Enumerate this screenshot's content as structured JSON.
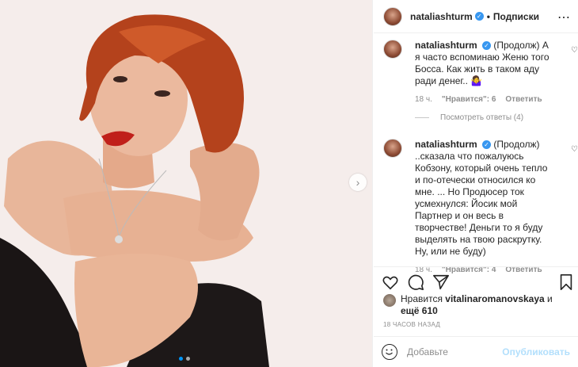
{
  "post": {
    "username": "nataliashturm",
    "separator": "•",
    "follow_label": "Подписки",
    "more_icon": "ellipsis-icon"
  },
  "comments": [
    {
      "username": "nataliashturm",
      "prefix": "(Продолж)",
      "text": "А я часто вспоминаю Женю того Босса. Как жить в таком аду ради денег..",
      "emoji": "🤷‍♀️",
      "time": "18 ч.",
      "likes": "\"Нравится\": 6",
      "reply": "Ответить"
    },
    {
      "username": "nataliashturm",
      "prefix": "(Продолж)",
      "text": "..сказала что пожалуюсь Кобзону, который очень тепло и по-отечески относился ко мне. ... Но Продюсер ток усмехнулся: Йосик мой Партнер и он весь в творчестве! Деньги то я буду выделять на твою раскрутку. Ну, или не буду)",
      "time": "18 ч.",
      "likes": "\"Нравится\": 4",
      "reply": "Ответить"
    }
  ],
  "view_replies": "Посмотреть ответы (4)",
  "likes_line": {
    "prefix": "Нравится",
    "user": "vitalinaromanovskaya",
    "suffix": "и",
    "others": "ещё 610"
  },
  "timestamp": "18 ЧАСОВ НАЗАД",
  "add_comment": {
    "placeholder": "Добавьте",
    "publish": "Опубликовать"
  },
  "colors": {
    "accent": "#0095f6",
    "verified": "#3897f0",
    "publish_disabled": "#b2dffc",
    "muted": "#8e8e8e"
  }
}
